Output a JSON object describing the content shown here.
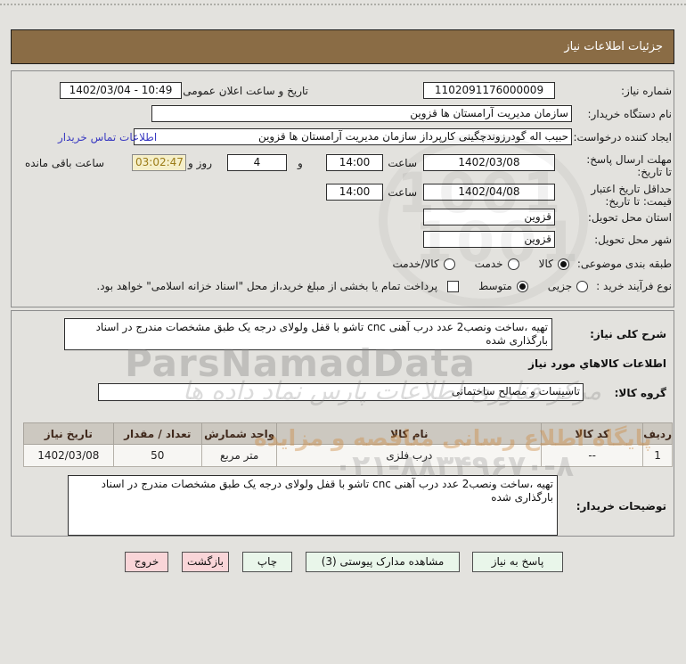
{
  "titlebar": {
    "title": "جزئیات اطلاعات نیاز",
    "bg": "#8a6c45"
  },
  "form": {
    "need_number": {
      "label": "شماره نیاز:",
      "value": "1102091176000009"
    },
    "announce": {
      "label": "تاریخ و ساعت اعلان عمومی:",
      "value": "1402/03/04 - 10:49"
    },
    "buyer_org": {
      "label": "نام دستگاه خریدار:",
      "value": "سازمان مدیریت آرامستان ها قزوین"
    },
    "creator": {
      "label": "ایجاد کننده درخواست:",
      "value": "حبیب اله گودرزوندچگینی کارپرداز سازمان مدیریت آرامستان ها قزوین",
      "contact_link": "اطلاعات تماس خریدار"
    },
    "deadline": {
      "label": "مهلت ارسال پاسخ: تا تاریخ:",
      "date": "1402/03/08",
      "hour_label": "ساعت",
      "hour": "14:00",
      "and_label": "و",
      "days": "4",
      "days_label": "روز و",
      "remaining": "03:02:47",
      "remaining_label": "ساعت باقی مانده",
      "remaining_color": "#9b7b17",
      "remaining_bg": "#f5efc9"
    },
    "validity": {
      "label": "حداقل تاریخ اعتبار قیمت: تا تاریخ:",
      "date": "1402/04/08",
      "hour_label": "ساعت",
      "hour": "14:00"
    },
    "province": {
      "label": "استان محل تحویل:",
      "value": "قزوین"
    },
    "city": {
      "label": "شهر محل تحویل:",
      "value": "قزوین"
    },
    "classification": {
      "label": "طبقه بندی موضوعی:",
      "options": [
        {
          "label": "کالا",
          "selected": true
        },
        {
          "label": "خدمت",
          "selected": false
        },
        {
          "label": "کالا/خدمت",
          "selected": false
        }
      ]
    },
    "process": {
      "label": "نوع فرآیند خرید :",
      "options": [
        {
          "label": "جزیی",
          "selected": false
        },
        {
          "label": "متوسط",
          "selected": true
        }
      ],
      "checkbox_label": "پرداخت تمام یا بخشی از مبلغ خرید،از محل \"اسناد خزانه اسلامی\" خواهد بود.",
      "checkbox_checked": false
    }
  },
  "details": {
    "desc_label": "شرح کلی نیاز:",
    "desc_value": "تهیه ،ساخت ونصب2 عدد درب آهنی cnc تاشو با قفل ولولای درجه یک  طبق مشخصات مندرج در اسناد بارگذاری شده",
    "goods_heading": "اطلاعات کالاهاي مورد نیاز",
    "group_label": "گروه کالا:",
    "group_value": "تاسیسات و مصالح ساختمانی",
    "table": {
      "headers": [
        "ردیف",
        "کد کالا",
        "نام کالا",
        "واحد شمارش",
        "تعداد / مقدار",
        "تاریخ نیاز"
      ],
      "rows": [
        [
          "1",
          "--",
          "درب فلزی",
          "متر مربع",
          "50",
          "1402/03/08"
        ]
      ]
    },
    "notes_label": "توضیحات خریدار:",
    "notes_value": "تهیه ،ساخت ونصب2 عدد درب آهنی cnc تاشو با قفل ولولای درجه یک  طبق مشخصات مندرج در اسناد بارگذاری شده"
  },
  "buttons": {
    "respond": "پاسخ به نیاز",
    "attachments": "مشاهده مدارک پیوستی (3)",
    "print": "چاپ",
    "back": "بازگشت",
    "exit": "خروج",
    "positive_bg": "#e9f6ea",
    "negative_bg": "#f9d5d8"
  },
  "watermark": {
    "brand": "ParsNamadData",
    "calligraphy": "مرکز فناوری اطلاعات پارس نماد داده ها",
    "portal": "پایگاه اطلاع رسانی مناقصه و مزایده",
    "phone": "۰۲۱-۸۸۳۴۹۶۷۰-۸",
    "logo_digits": "1001"
  }
}
